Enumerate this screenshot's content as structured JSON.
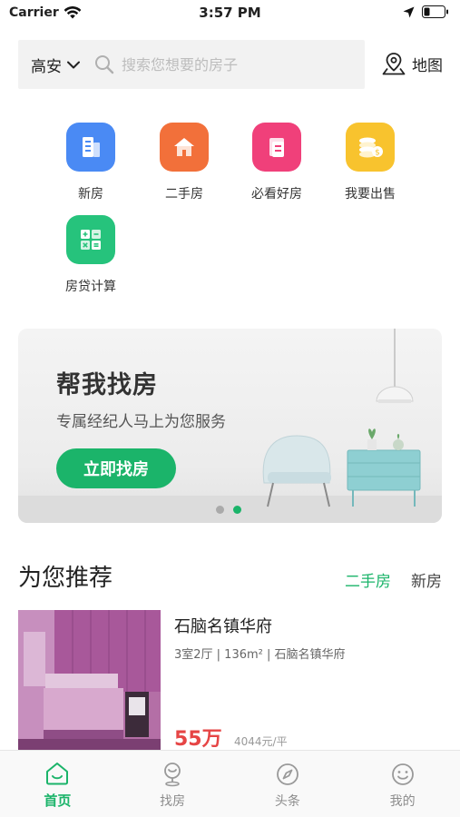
{
  "status_bar": {
    "carrier": "Carrier",
    "time": "3:57 PM"
  },
  "search": {
    "city": "高安",
    "placeholder": "搜索您想要的房子",
    "map_label": "地图"
  },
  "categories": [
    {
      "label": "新房",
      "color": "#4a8af4",
      "icon": "building-icon"
    },
    {
      "label": "二手房",
      "color": "#f2703a",
      "icon": "house-icon"
    },
    {
      "label": "必看好房",
      "color": "#f0407a",
      "icon": "document-icon"
    },
    {
      "label": "我要出售",
      "color": "#f8c32e",
      "icon": "coins-icon"
    },
    {
      "label": "房贷计算",
      "color": "#26c37c",
      "icon": "calculator-icon"
    }
  ],
  "banner": {
    "title": "帮我找房",
    "subtitle": "专属经纪人马上为您服务",
    "button": "立即找房"
  },
  "recommend": {
    "title": "为您推荐",
    "tabs": [
      "二手房",
      "新房"
    ],
    "active_tab": "二手房",
    "listing": {
      "title": "石脑名镇华府",
      "meta": "3室2厅 | 136m² | 石脑名镇华府",
      "price": "55万",
      "unit_price": "4044元/平"
    }
  },
  "tab_bar": [
    {
      "label": "首页",
      "icon": "home-icon",
      "active": true
    },
    {
      "label": "找房",
      "icon": "location-pin-icon",
      "active": false
    },
    {
      "label": "头条",
      "icon": "compass-icon",
      "active": false
    },
    {
      "label": "我的",
      "icon": "smiley-icon",
      "active": false
    }
  ],
  "colors": {
    "accent": "#1bb46a",
    "price": "#e64545"
  }
}
